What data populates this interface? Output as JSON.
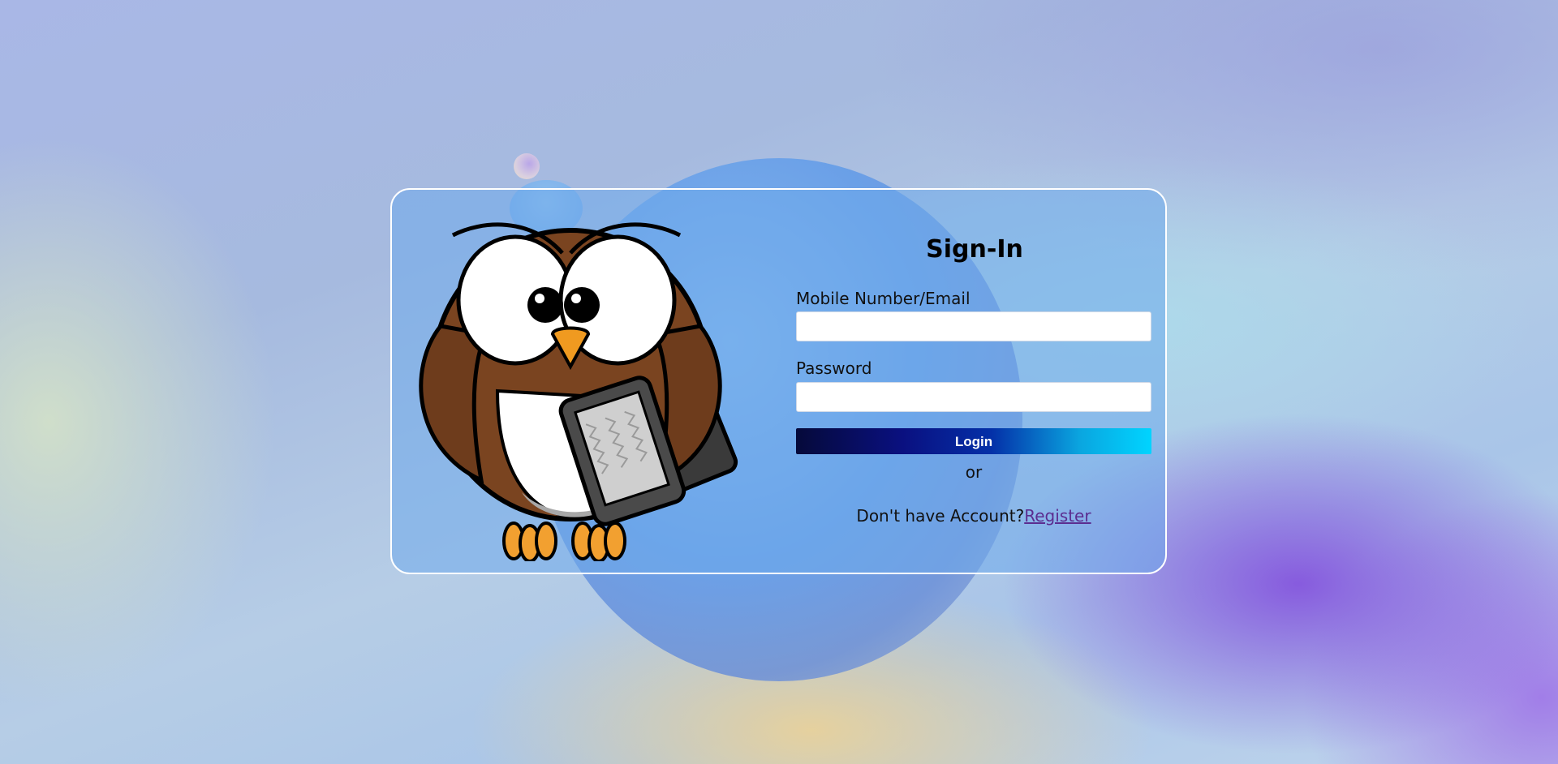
{
  "signin": {
    "title": "Sign-In",
    "username_label": "Mobile Number/Email",
    "username_value": "",
    "password_label": "Password",
    "password_value": "",
    "login_label": "Login",
    "or_text": "or",
    "no_account_text": "Don't have Account?",
    "register_label": "Register"
  },
  "illustration": {
    "icon": "owl-with-ereader-icon"
  },
  "colors": {
    "card_border": "#ffffff",
    "button_gradient_start": "#050a3a",
    "button_gradient_end": "#00d4ff",
    "register_link": "#5b2d90"
  }
}
